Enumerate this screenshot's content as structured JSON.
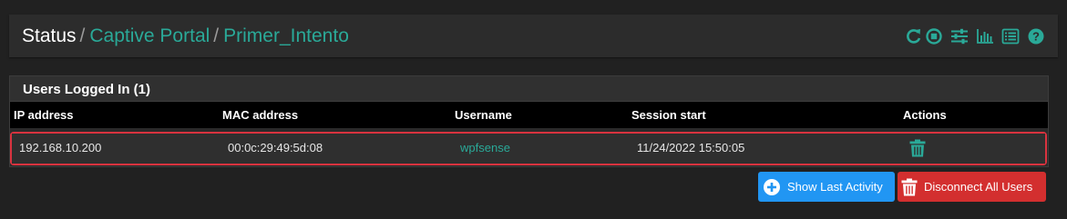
{
  "header": {
    "breadcrumb": {
      "root": "Status",
      "separator": "/",
      "section": "Captive Portal",
      "zone": "Primer_Intento"
    },
    "icons": [
      "reload-icon",
      "stop-icon",
      "sliders-icon",
      "bar-chart-icon",
      "list-icon",
      "help-icon"
    ]
  },
  "panel": {
    "title": "Users Logged In (1)",
    "columns": {
      "ip": "IP address",
      "mac": "MAC address",
      "username": "Username",
      "session": "Session start",
      "actions": "Actions"
    },
    "rows": [
      {
        "ip": "192.168.10.200",
        "mac": "00:0c:29:49:5d:08",
        "username": "wpfsense",
        "session_start": "11/24/2022 15:50:05",
        "action_icon": "trash-icon"
      }
    ]
  },
  "buttons": {
    "show_last_activity": "Show Last Activity",
    "disconnect_all": "Disconnect All Users"
  },
  "colors": {
    "accent": "#2aa998",
    "info": "#2196f3",
    "danger": "#d32f2f",
    "highlight_border": "#d9333f",
    "background": "#212121"
  }
}
